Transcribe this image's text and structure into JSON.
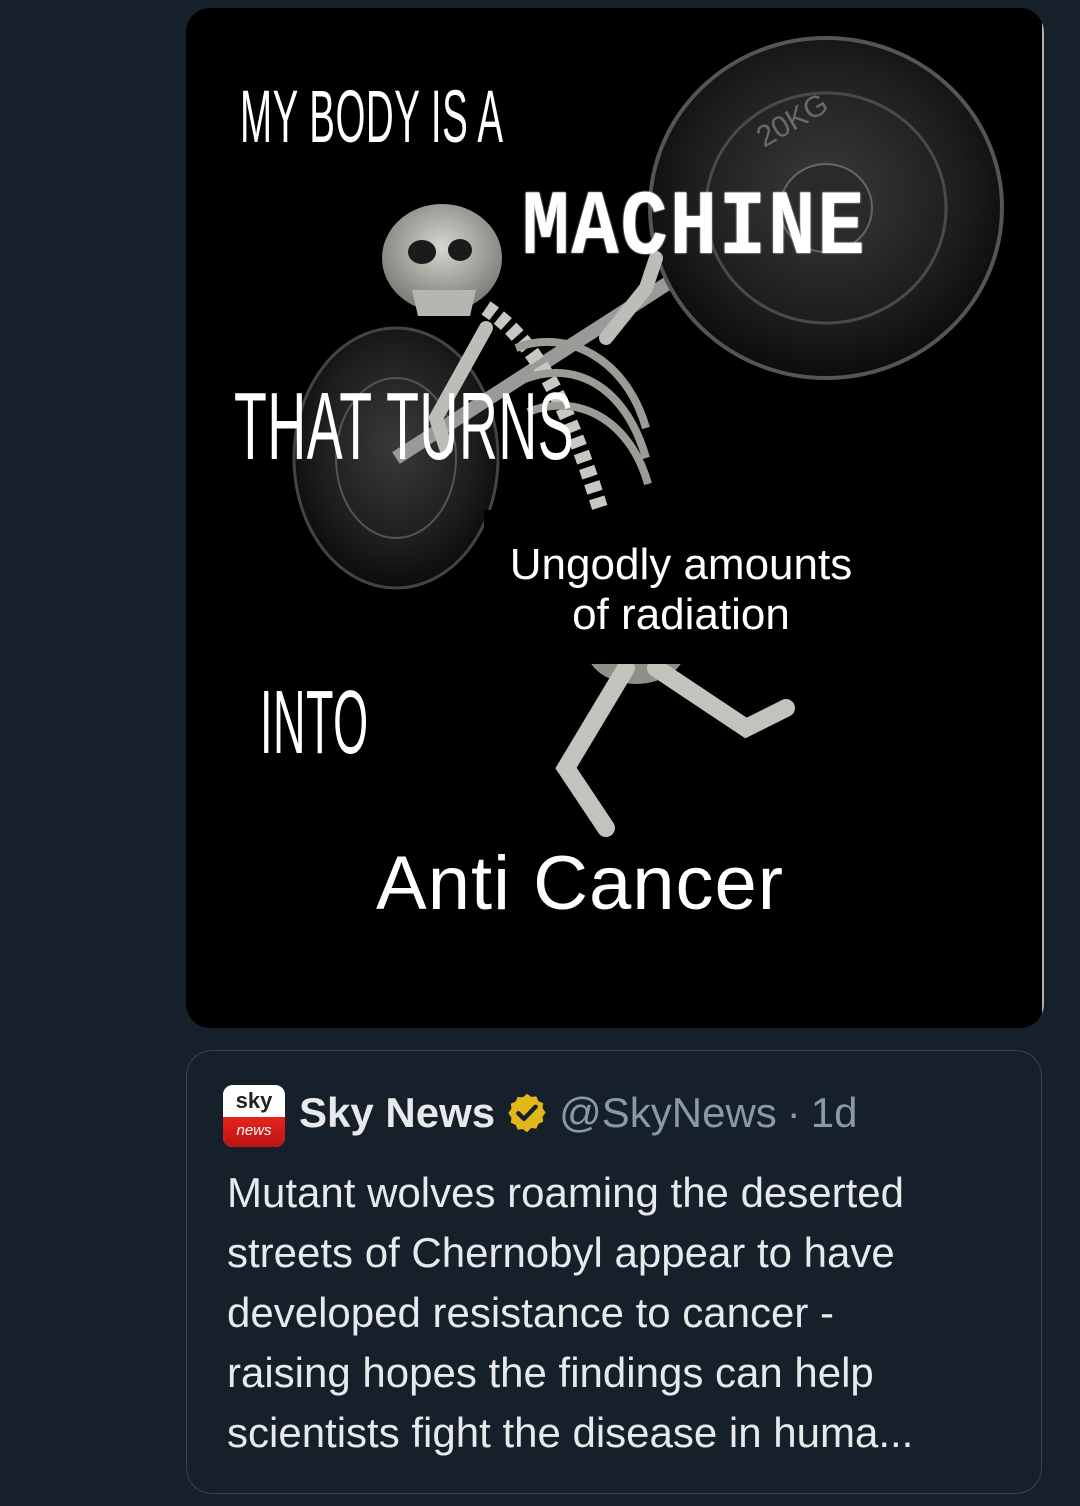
{
  "meme": {
    "line1": "MY BODY IS A",
    "line2": "MACHINE",
    "line3": "THAT TURNS",
    "label_line1": "Ungodly amounts",
    "label_line2": "of radiation",
    "line4": "INTO",
    "line5": "Anti Cancer",
    "plate_mark": "20KG"
  },
  "quoted_tweet": {
    "avatar_top": "sky",
    "avatar_bottom": "news",
    "author": "Sky News",
    "handle": "@SkyNews",
    "separator": "·",
    "time": "1d",
    "text_lines": [
      "Mutant wolves roaming the deserted",
      "streets of Chernobyl appear to have",
      "developed resistance to cancer -",
      "raising hopes the findings can help",
      "scientists fight the disease in huma..."
    ]
  },
  "colors": {
    "background": "#15202b",
    "text_primary": "#e7e9ea",
    "text_secondary": "#8b98a5",
    "border": "#38444d",
    "verified_gold": "#e2b719",
    "brand_red": "#e8221e"
  },
  "icons": {
    "verified": "gold-check-badge"
  }
}
